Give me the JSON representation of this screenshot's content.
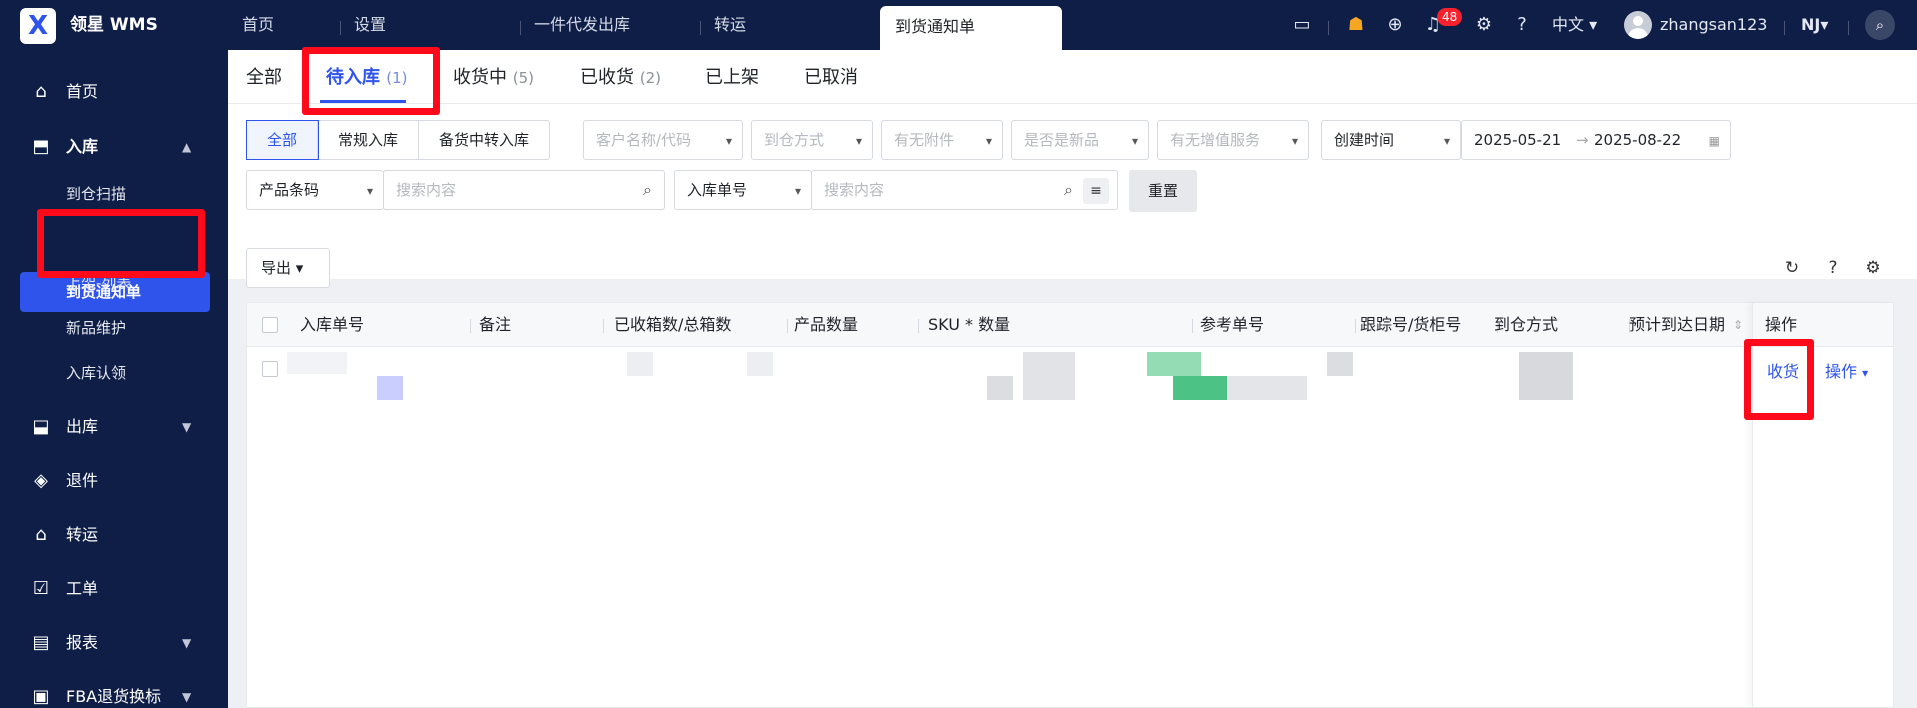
{
  "app": {
    "name": "领星 WMS",
    "logo_letter": "X"
  },
  "nav_tabs": [
    "首页",
    "设置",
    "一件代发出库",
    "转运"
  ],
  "active_tab": "到货通知单",
  "topbar": {
    "notification_count": "48",
    "language": "中文",
    "username": "zhangsan123",
    "org": "NJ"
  },
  "sidebar": {
    "items": [
      {
        "label": "首页",
        "icon": "home-icon"
      },
      {
        "label": "入库",
        "icon": "inbound-icon"
      },
      {
        "label": "出库",
        "icon": "outbound-icon"
      },
      {
        "label": "退件",
        "icon": "return-icon"
      },
      {
        "label": "转运",
        "icon": "transfer-icon"
      },
      {
        "label": "工单",
        "icon": "work-order-icon"
      },
      {
        "label": "报表",
        "icon": "report-icon"
      },
      {
        "label": "FBA退货换标",
        "icon": "fba-icon"
      }
    ],
    "sub_items": [
      "到仓扫描",
      "到货通知单",
      "上架-列表",
      "新品维护",
      "入库认领"
    ]
  },
  "status_tabs": [
    {
      "label": "全部",
      "count": ""
    },
    {
      "label": "待入库",
      "count": "(1)"
    },
    {
      "label": "收货中",
      "count": "(5)"
    },
    {
      "label": "已收货",
      "count": "(2)"
    },
    {
      "label": "已上架",
      "count": ""
    },
    {
      "label": "已取消",
      "count": ""
    }
  ],
  "filters": {
    "inbound_types": [
      "全部",
      "常规入库",
      "备货中转入库"
    ],
    "customer_placeholder": "客户名称/代码",
    "arrival_method_placeholder": "到仓方式",
    "attachment_placeholder": "有无附件",
    "new_product_placeholder": "是否是新品",
    "value_added_placeholder": "有无增值服务",
    "time_field": "创建时间",
    "date_start": "2025-05-21",
    "date_end": "2025-08-22",
    "date_arrow": "→",
    "product_field": "产品条码",
    "search_placeholder": "搜索内容",
    "order_field": "入库单号",
    "reset_label": "重置"
  },
  "toolbar": {
    "export_label": "导出"
  },
  "table": {
    "columns": [
      "入库单号",
      "备注",
      "已收箱数/总箱数",
      "产品数量",
      "SKU * 数量",
      "参考单号",
      "跟踪号/货柜号",
      "到仓方式",
      "预计到达日期",
      "操作"
    ],
    "row_actions": {
      "receive": "收货",
      "more": "操作"
    }
  },
  "colors": {
    "primary": "#2f54eb",
    "sidebar_bg": "#0f1e47",
    "highlight": "#ff0a1a"
  }
}
